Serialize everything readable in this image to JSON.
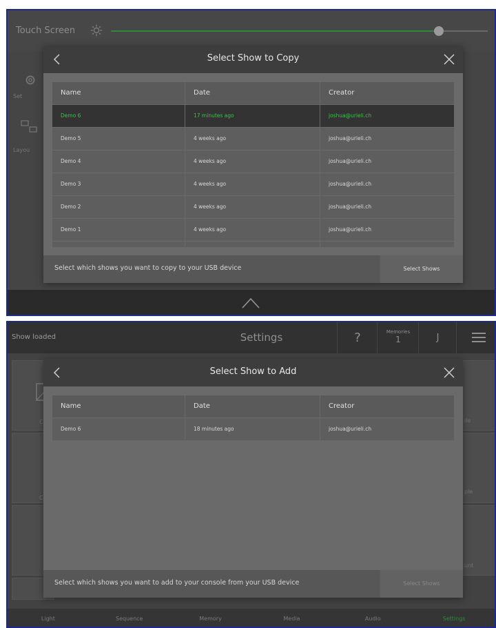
{
  "screen1": {
    "background": {
      "title": "Touch Screen",
      "brightness": 0.87,
      "side_items": [
        "Set",
        "Layou"
      ]
    },
    "dialog": {
      "title": "Select Show to Copy",
      "columns": [
        "Name",
        "Date",
        "Creator"
      ],
      "rows": [
        {
          "name": "Demo 6",
          "date": "17 minutes ago",
          "creator": "joshua@urieli.ch",
          "selected": true
        },
        {
          "name": "Demo 5",
          "date": "4 weeks ago",
          "creator": "joshua@urieli.ch",
          "selected": false
        },
        {
          "name": "Demo 4",
          "date": "4 weeks ago",
          "creator": "joshua@urieli.ch",
          "selected": false
        },
        {
          "name": "Demo 3",
          "date": "4 weeks ago",
          "creator": "joshua@urieli.ch",
          "selected": false
        },
        {
          "name": "Demo 2",
          "date": "4 weeks ago",
          "creator": "joshua@urieli.ch",
          "selected": false
        },
        {
          "name": "Demo 1",
          "date": "4 weeks ago",
          "creator": "joshua@urieli.ch",
          "selected": false
        }
      ],
      "footer_text": "Select which shows you want to copy to your USB device",
      "action_label": "Select Shows"
    }
  },
  "screen2": {
    "header": {
      "status": "Show loaded",
      "title": "Settings",
      "help": "?",
      "memories_label": "Memories",
      "memories_count": "1",
      "user_initial": "J"
    },
    "background": {
      "left_labels": [
        "C",
        "C"
      ],
      "right_labels": [
        "ile",
        "ple",
        "unt"
      ]
    },
    "dialog": {
      "title": "Select Show to Add",
      "columns": [
        "Name",
        "Date",
        "Creator"
      ],
      "rows": [
        {
          "name": "Demo 6",
          "date": "18 minutes ago",
          "creator": "joshua@urieli.ch",
          "selected": false
        }
      ],
      "footer_text": "Select which shows you want to add to your console from your USB device",
      "action_label": "Select Shows"
    },
    "nav": [
      "Light",
      "Sequence",
      "Memory",
      "Media",
      "Audio",
      "Settings"
    ],
    "active_nav": "Settings"
  },
  "colors": {
    "accent_green": "#3cc04c",
    "nav_active_green": "#2b8a3a",
    "frame_border": "#1c2a8a"
  }
}
